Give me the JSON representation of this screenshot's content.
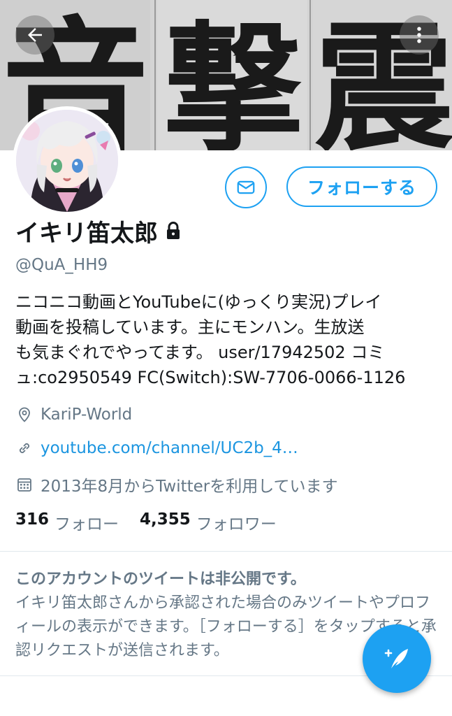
{
  "header": {
    "back_icon": "back-arrow-icon",
    "more_icon": "more-vertical-icon",
    "banner_text": [
      "音",
      "撃",
      "震"
    ]
  },
  "profile": {
    "display_name": "イキリ笛太郎",
    "protected_icon": "lock-icon",
    "handle": "@QuA_HH9",
    "bio_lines": [
      "ニコニコ動画とYouTubeに(ゆっくり実況)プレイ",
      "動画を投稿しています。主にモンハン。生放送",
      "も気まぐれでやってます。 user/17942502 コミ",
      "ュ:co2950549  FC(Switch):SW-7706-0066-1126"
    ],
    "location": "KariP-World",
    "website": "youtube.com/channel/UC2b_4…",
    "joined": "2013年8月からTwitterを利用しています"
  },
  "actions": {
    "message_icon": "envelope-icon",
    "follow_label": "フォローする",
    "compose_icon": "compose-tweet-icon"
  },
  "stats": {
    "following_count": "316",
    "following_label": "フォロー",
    "followers_count": "4,355",
    "followers_label": "フォロワー"
  },
  "protected_notice": {
    "title": "このアカウントのツイートは非公開です。",
    "body": "イキリ笛太郎さんから承認された場合のみツイートやプロフィールの表示ができます。［フォローする］をタップすると承認リクエストが送信されます。"
  },
  "colors": {
    "accent": "#1da1f2",
    "link": "#1b95e0",
    "text": "#14171a",
    "muted": "#657786"
  }
}
